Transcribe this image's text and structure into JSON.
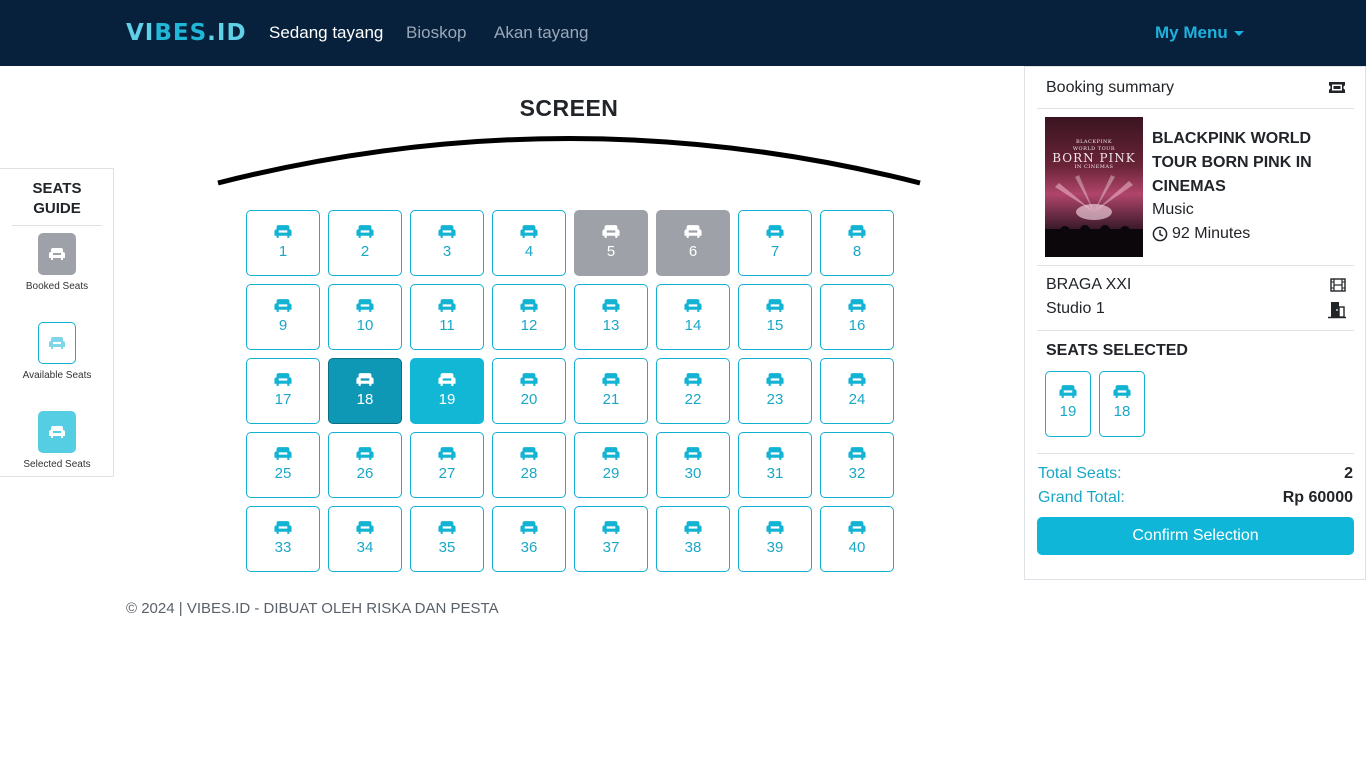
{
  "navbar": {
    "brand_main": "VI",
    "brand_alt": "BES",
    "brand_end": ".ID",
    "links": [
      "Sedang tayang",
      "Bioskop",
      "Akan tayang"
    ],
    "menu_label": "My Menu"
  },
  "guide": {
    "title": "SEATS GUIDE",
    "booked_label": "Booked Seats",
    "available_label": "Available Seats",
    "selected_label": "Selected Seats"
  },
  "screen": {
    "label": "SCREEN"
  },
  "seats": [
    {
      "num": "1",
      "state": "available"
    },
    {
      "num": "2",
      "state": "available"
    },
    {
      "num": "3",
      "state": "available"
    },
    {
      "num": "4",
      "state": "available"
    },
    {
      "num": "5",
      "state": "booked"
    },
    {
      "num": "6",
      "state": "booked"
    },
    {
      "num": "7",
      "state": "available"
    },
    {
      "num": "8",
      "state": "available"
    },
    {
      "num": "9",
      "state": "available"
    },
    {
      "num": "10",
      "state": "available"
    },
    {
      "num": "11",
      "state": "available"
    },
    {
      "num": "12",
      "state": "available"
    },
    {
      "num": "13",
      "state": "available"
    },
    {
      "num": "14",
      "state": "available"
    },
    {
      "num": "15",
      "state": "available"
    },
    {
      "num": "16",
      "state": "available"
    },
    {
      "num": "17",
      "state": "available"
    },
    {
      "num": "18",
      "state": "selected"
    },
    {
      "num": "19",
      "state": "selected-alt"
    },
    {
      "num": "20",
      "state": "available"
    },
    {
      "num": "21",
      "state": "available"
    },
    {
      "num": "22",
      "state": "available"
    },
    {
      "num": "23",
      "state": "available"
    },
    {
      "num": "24",
      "state": "available"
    },
    {
      "num": "25",
      "state": "available"
    },
    {
      "num": "26",
      "state": "available"
    },
    {
      "num": "27",
      "state": "available"
    },
    {
      "num": "28",
      "state": "available"
    },
    {
      "num": "29",
      "state": "available"
    },
    {
      "num": "30",
      "state": "available"
    },
    {
      "num": "31",
      "state": "available"
    },
    {
      "num": "32",
      "state": "available"
    },
    {
      "num": "33",
      "state": "available"
    },
    {
      "num": "34",
      "state": "available"
    },
    {
      "num": "35",
      "state": "available"
    },
    {
      "num": "36",
      "state": "available"
    },
    {
      "num": "37",
      "state": "available"
    },
    {
      "num": "38",
      "state": "available"
    },
    {
      "num": "39",
      "state": "available"
    },
    {
      "num": "40",
      "state": "available"
    }
  ],
  "footer": "© 2024 | VIBES.ID - DIBUAT OLEH RISKA DAN PESTA",
  "summary": {
    "title": "Booking summary",
    "movie": {
      "title": "BLACKPINK WORLD TOUR BORN PINK IN CINEMAS",
      "genre": "Music",
      "duration": "92 Minutes",
      "poster_top": "BLACKPINK",
      "poster_sub": "WORLD TOUR",
      "poster_main": "BORN PINK",
      "poster_tag": "IN CINEMAS"
    },
    "cinema": "BRAGA XXI",
    "studio": "Studio 1",
    "seats_selected_title": "SEATS SELECTED",
    "selected_seats": [
      "19",
      "18"
    ],
    "total_seats_label": "Total Seats:",
    "total_seats_value": "2",
    "grand_total_label": "Grand Total:",
    "grand_total_value": "Rp 60000",
    "confirm_label": "Confirm Selection"
  },
  "colors": {
    "navbar": "#07213d",
    "accent": "#10b6d8",
    "booked": "#9ea2a8",
    "selected": "#0e98b5"
  }
}
